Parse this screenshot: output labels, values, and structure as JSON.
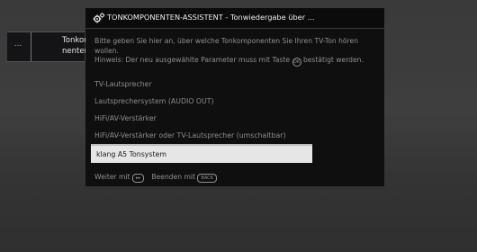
{
  "background": {
    "color": "#3a3a3c"
  },
  "left_panel": {
    "dots": "...",
    "label": "Tonkompo-\nnenten"
  },
  "dialog": {
    "icon": "gear-icon",
    "title": "TONKOMPONENTEN-ASSISTENT - Tonwiedergabe über ...",
    "message_line1": "Bitte geben Sie hier an, über welche Tonkomponenten Sie Ihren TV-Ton hören",
    "message_line2": "wollen.",
    "hint_before": "Hinweis: Der neu ausgewählte Parameter muss mit Taste",
    "hint_key": "OK",
    "hint_after": "bestätigt werden.",
    "options": [
      {
        "label": "TV-Lautsprecher",
        "selected": false
      },
      {
        "label": "Lautsprechersystem (AUDIO OUT)",
        "selected": false
      },
      {
        "label": "HiFi/AV-Verstärker",
        "selected": false
      },
      {
        "label": "HiFi/AV-Verstärker oder TV-Lautsprecher (umschaltbar)",
        "selected": false
      },
      {
        "label": "klang A5 Tonsystem",
        "selected": true
      }
    ],
    "footer": {
      "next_label": "Weiter mit",
      "next_key": "▸▸",
      "exit_label": "Beenden mit",
      "exit_key": "BACK"
    }
  },
  "colors": {
    "dialog_bg": "#0f0f10",
    "selected_bg": "#e6e6e6",
    "text_dim": "#8f8f8f",
    "title_text": "#ececec"
  }
}
